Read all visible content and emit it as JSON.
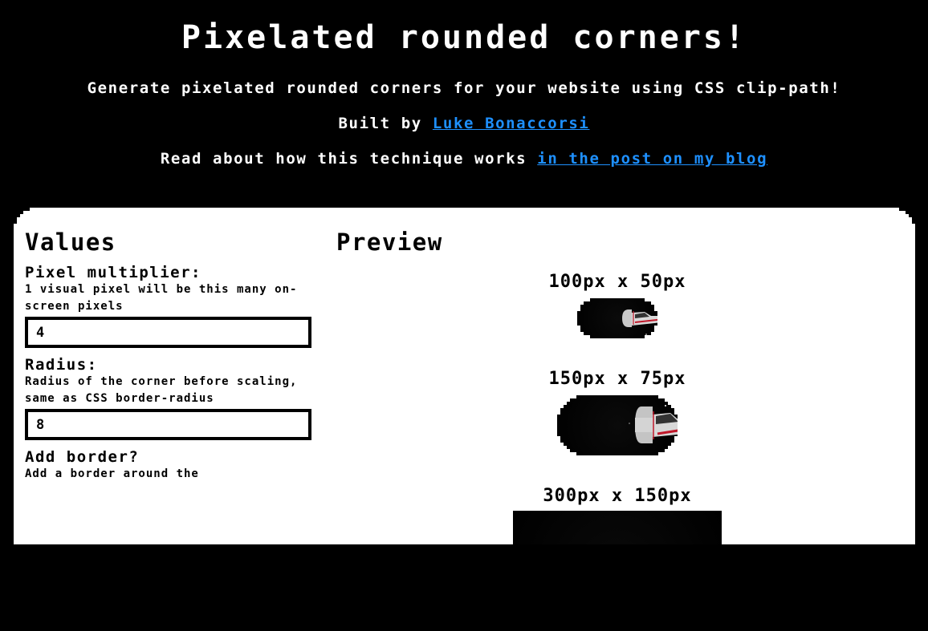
{
  "header": {
    "title": "Pixelated rounded corners!",
    "subtitle": "Generate pixelated rounded corners for your website using CSS clip-path!",
    "built_by_prefix": "Built by",
    "author_link": "Luke Bonaccorsi",
    "read_prefix": "Read about how this technique works",
    "blog_link": "in the post on my blog",
    "link_color": "#1e90ff"
  },
  "values": {
    "heading": "Values",
    "fields": [
      {
        "label": "Pixel multiplier:",
        "hint": "1 visual pixel will be this many on-screen pixels",
        "value": "4"
      },
      {
        "label": "Radius:",
        "hint": "Radius of the corner before scaling, same as CSS border-radius",
        "value": "8"
      },
      {
        "label": "Add border?",
        "hint": "Add a border around the"
      }
    ]
  },
  "preview": {
    "heading": "Preview",
    "items": [
      {
        "label": "100px x 50px"
      },
      {
        "label": "150px x 75px"
      },
      {
        "label": "300px x 150px"
      }
    ]
  }
}
